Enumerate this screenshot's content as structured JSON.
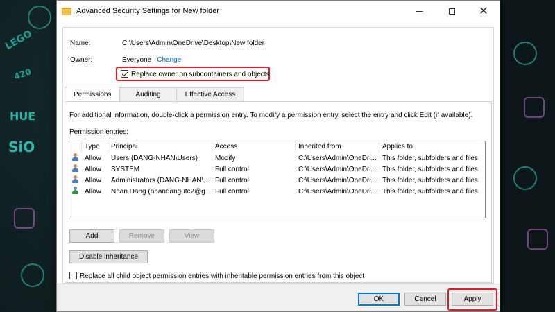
{
  "window": {
    "title": "Advanced Security Settings for New folder",
    "minimize_label": "Minimize",
    "maximize_label": "Maximize",
    "close_label": "✕"
  },
  "name": {
    "label": "Name:",
    "value": "C:\\Users\\Admin\\OneDrive\\Desktop\\New folder"
  },
  "owner": {
    "label": "Owner:",
    "value": "Everyone",
    "change_link": "Change"
  },
  "replace_owner": {
    "label": "Replace owner on subcontainers and objects",
    "checked": true
  },
  "tabs": [
    {
      "label": "Permissions",
      "active": true
    },
    {
      "label": "Auditing",
      "active": false
    },
    {
      "label": "Effective Access",
      "active": false
    }
  ],
  "permissions": {
    "info_text": "For additional information, double-click a permission entry. To modify a permission entry, select the entry and click Edit (if available).",
    "entries_label": "Permission entries:",
    "columns": [
      "Type",
      "Principal",
      "Access",
      "Inherited from",
      "Applies to"
    ],
    "rows": [
      {
        "icon": "user-group-icon",
        "type": "Allow",
        "principal": "Users (DANG-NHAN\\Users)",
        "access": "Modify",
        "inherited": "C:\\Users\\Admin\\OneDri...",
        "applies": "This folder, subfolders and files"
      },
      {
        "icon": "user-group-icon",
        "type": "Allow",
        "principal": "SYSTEM",
        "access": "Full control",
        "inherited": "C:\\Users\\Admin\\OneDri...",
        "applies": "This folder, subfolders and files"
      },
      {
        "icon": "user-group-icon",
        "type": "Allow",
        "principal": "Administrators (DANG-NHAN\\...",
        "access": "Full control",
        "inherited": "C:\\Users\\Admin\\OneDri...",
        "applies": "This folder, subfolders and files"
      },
      {
        "icon": "user-icon",
        "type": "Allow",
        "principal": "Nhan Dang (nhandangutc2@g...",
        "access": "Full control",
        "inherited": "C:\\Users\\Admin\\OneDri...",
        "applies": "This folder, subfolders and files"
      }
    ],
    "add_label": "Add",
    "remove_label": "Remove",
    "view_label": "View",
    "disable_inheritance_label": "Disable inheritance",
    "replace_child_label": "Replace all child object permission entries with inheritable permission entries from this object",
    "replace_child_checked": false
  },
  "footer": {
    "ok_label": "OK",
    "cancel_label": "Cancel",
    "apply_label": "Apply"
  },
  "background_doodles": [
    "LEGO",
    "HUE",
    "SiO",
    "420"
  ],
  "colors": {
    "highlight": "#e01b24",
    "link": "#0066cc",
    "accent": "#0078d7"
  }
}
